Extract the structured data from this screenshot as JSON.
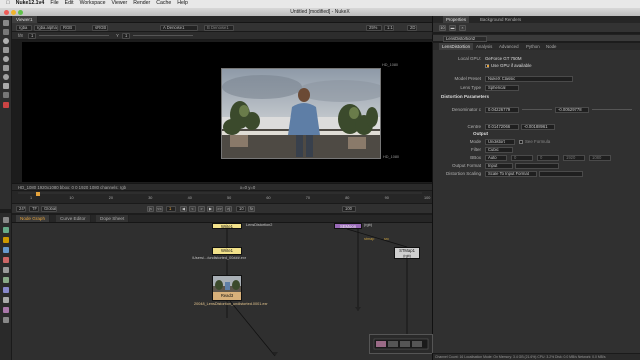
{
  "menubar": {
    "apple": "",
    "items": [
      "Nuke12.1v4",
      "File",
      "Edit",
      "Workspace",
      "Viewer",
      "Render",
      "Cache",
      "Help"
    ]
  },
  "window": {
    "title": "Untitled [modified] - NukeX"
  },
  "viewer": {
    "tab": "Viewer1",
    "channels": "rgba",
    "alpha": "rgba.alpha",
    "colorspace": "RGB",
    "display": "sRGB",
    "input_a": "A Denoise1",
    "input_b": "B Denoise1",
    "zoom": "25%",
    "ratio": "1:1",
    "mode": "2D",
    "gain_label": "f/8",
    "gain_value": "1",
    "gamma_label": "Y",
    "gamma_value": "1",
    "format_tag": "HD_1080",
    "format_tag2": "HD_1080",
    "info_left": "HD_1080 1920x1080  bbox: 0 0 1920 1080 channels: rgb",
    "info_coords": "x=0 y=0"
  },
  "timeline": {
    "ticks": [
      "1",
      "10",
      "20",
      "30",
      "40",
      "50",
      "60",
      "70",
      "80",
      "90",
      "100"
    ],
    "fps": "24*",
    "tf": "TF",
    "global": "Global",
    "frame": "1",
    "step": "10",
    "end": "100"
  },
  "nodegraph": {
    "tabs": [
      "Node Graph",
      "Curve Editor",
      "Dope Sheet"
    ],
    "nodes": {
      "a": "Write1",
      "a_sub": "",
      "b": "LensDistortion2",
      "c": "Write1",
      "c_file": "/Users/.../undistorted_00###.exr",
      "d": "Read3",
      "d_file": "20048_LensDistortion_undistorted.0001.exr",
      "e": "STMap1",
      "e_sub": "(rgb)",
      "f": "SEMoon",
      "f_sub": "(rgb)",
      "lbl_stmap": "stmap",
      "lbl_src": "src"
    }
  },
  "properties": {
    "tabs": [
      "Properties",
      "Background Renders"
    ],
    "node_name": "LensDistortion2",
    "subtabs": [
      "LensDistortion",
      "Analysis",
      "Advanced",
      "Python",
      "Node"
    ],
    "local_gpu_label": "Local GPU:",
    "local_gpu_value": "GeForce GT 750M",
    "use_gpu_label": "Use GPU if available",
    "model_preset_label": "Model Preset",
    "model_preset_value": "NukeX Classic",
    "lens_type_label": "Lens Type",
    "lens_type_value": "Spherical",
    "section_distortion": "Distortion Parameters",
    "denominator_label": "Denominator c",
    "denominator_values": [
      "0.04226779",
      "-0.00529778"
    ],
    "centre_label": "Centre",
    "centre_values": [
      "0.01472066",
      "-0.00188961"
    ],
    "section_output": "Output",
    "mode_label": "Mode",
    "mode_value": "Undistort",
    "see_formula_label": "See Formula",
    "filter_label": "Filter",
    "filter_value": "Cubic",
    "bbox_label": "BBox",
    "bbox_value": "Auto",
    "bbox_fields": [
      "0",
      "0",
      "1920",
      "1080"
    ],
    "output_format_label": "Output Format",
    "output_format_value": "Input",
    "distortion_scaling_label": "Distortion Scaling",
    "distortion_scaling_value": "Scale To Input Format"
  },
  "status": {
    "line": "Channel Count: 16  Localisation Mode: On  Memory: 3.4 GB (21.6%)  CPU: 3.2%  Disk: 0.0 MB/s  Network: 0.0 MB/s"
  },
  "colors": {
    "accent": "#e6a33c",
    "read_node": "#d8b07a",
    "write_node": "#f2e18a",
    "stmap_node": "#cfcfcf",
    "moon_node": "#9a6ab8"
  }
}
